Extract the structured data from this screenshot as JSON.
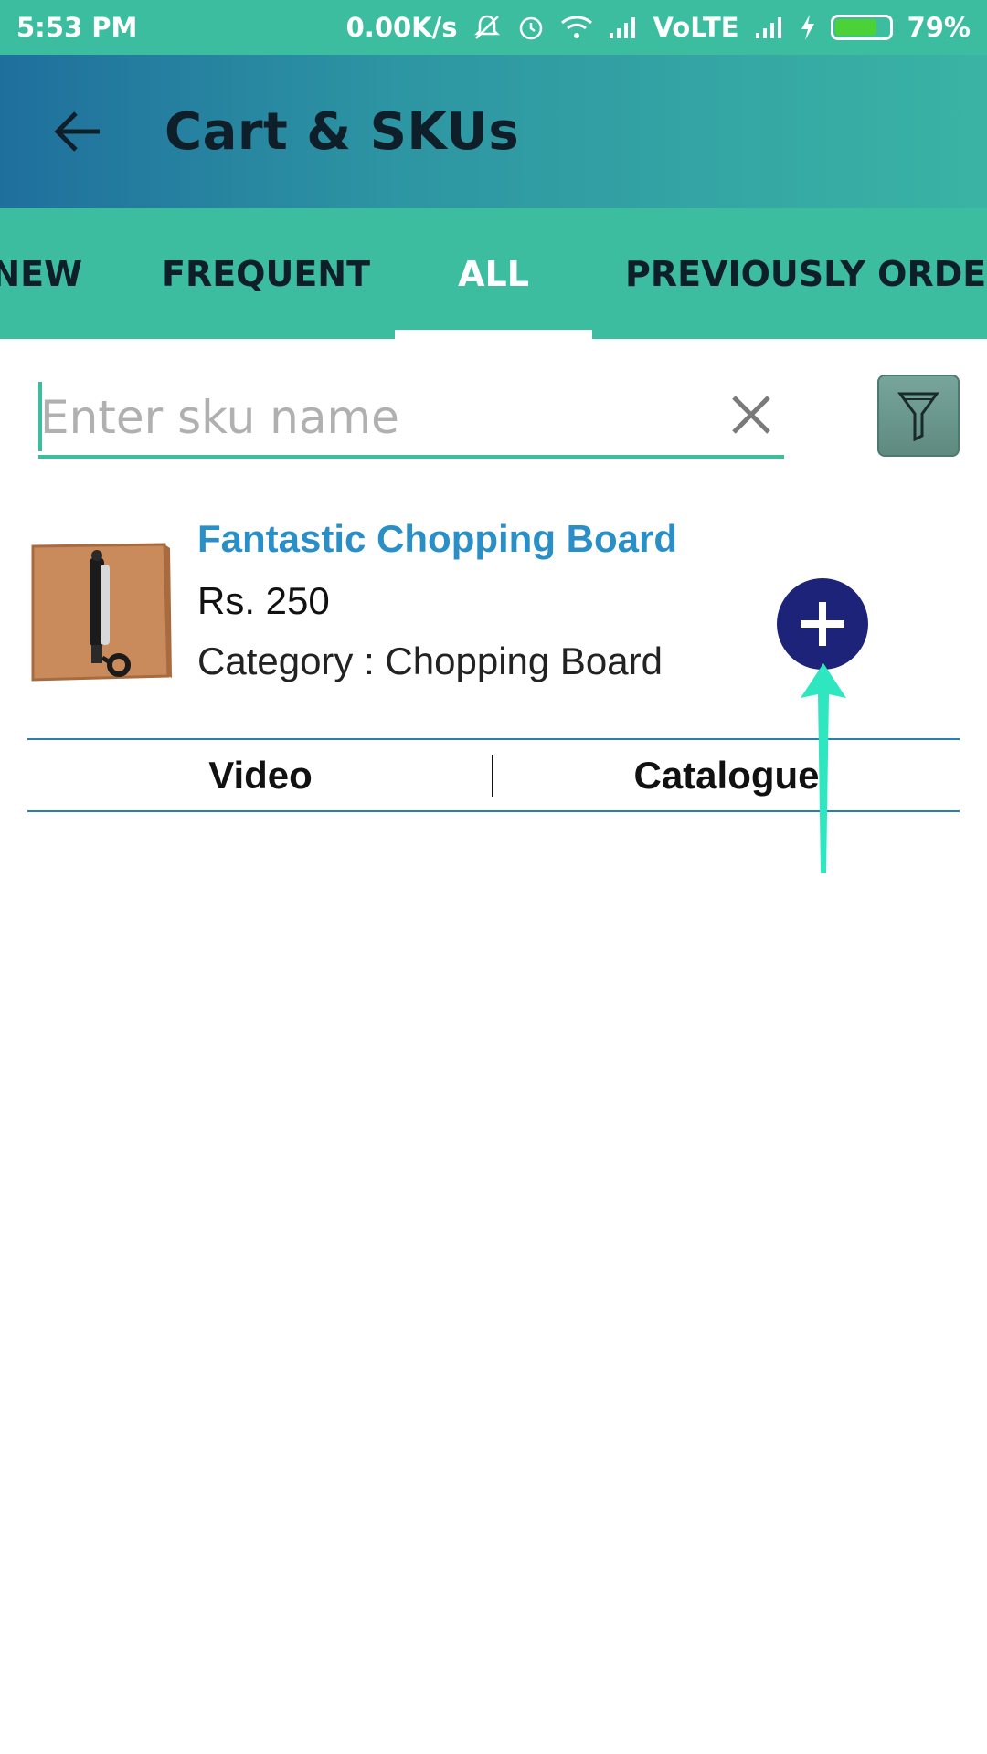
{
  "status_bar": {
    "time": "5:53 PM",
    "speed": "0.00K/s",
    "network": "VoLTE",
    "battery_percent": "79%",
    "battery_level": 0.79,
    "icons": [
      "mute-bell-icon",
      "alarm-icon",
      "wifi-icon",
      "signal-icon",
      "signal-icon",
      "charging-icon",
      "battery-icon"
    ]
  },
  "app_bar": {
    "title": "Cart & SKUs",
    "back_icon": "arrow-left-icon"
  },
  "tabs": [
    {
      "label": "NEW",
      "active": false
    },
    {
      "label": "FREQUENT",
      "active": false
    },
    {
      "label": "ALL",
      "active": true
    },
    {
      "label": "PREVIOUSLY ORDERED",
      "active": false
    }
  ],
  "search": {
    "placeholder": "Enter sku name",
    "value": "",
    "clear_icon": "close-icon",
    "filter_icon": "filter-icon"
  },
  "product": {
    "name": "Fantastic Chopping Board",
    "price": "Rs. 250",
    "category": "Category : Chopping Board",
    "image_icon": "chopping-board-image",
    "add_icon": "plus-icon"
  },
  "actions": {
    "video_label": "Video",
    "catalogue_label": "Catalogue"
  },
  "colors": {
    "teal": "#3dbd9f",
    "app_bar_start": "#1f6f9d",
    "product_name": "#2a8fc6",
    "add_button": "#1c2378",
    "annotation_arrow": "#2ee6c0"
  }
}
